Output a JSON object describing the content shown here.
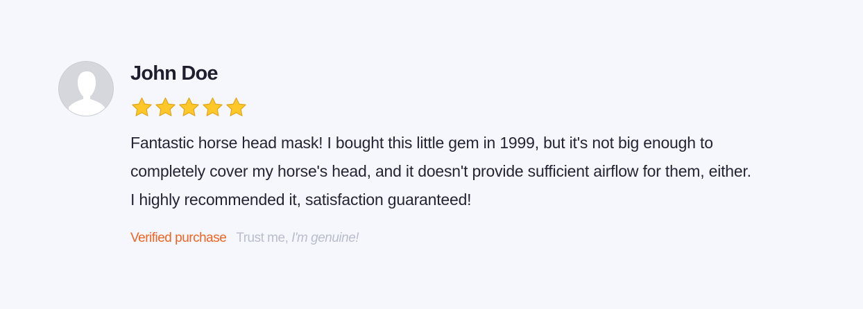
{
  "review": {
    "author": "John Doe",
    "rating": 5,
    "rating_max": 5,
    "text": "Fantastic horse head mask! I bought this little gem in 1999, but it's not big enough to completely cover my horse's head, and it doesn't provide sufficient airflow for them, either. I highly recommended it, satisfaction guaranteed!",
    "verified_label": "Verified purchase",
    "trust_prefix": "Trust me,",
    "trust_emphasis": "I'm genuine!"
  },
  "icons": {
    "avatar": "user-silhouette-icon",
    "star": "star-icon"
  },
  "colors": {
    "background": "#f5f7fd",
    "star": "#ffc727",
    "verified": "#ef6422",
    "muted": "#b9bdcc",
    "text": "#252433"
  }
}
